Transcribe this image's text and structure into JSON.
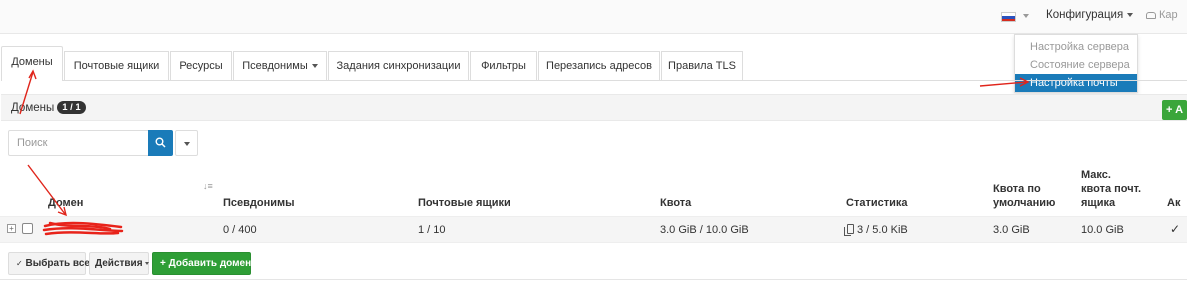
{
  "navbar": {
    "config_label": "Конфигурация",
    "account_label": "Кар"
  },
  "config_dropdown": [
    {
      "label": "Настройка сервера",
      "active": false
    },
    {
      "label": "Состояние сервера",
      "active": false
    },
    {
      "label": "Настройка почты",
      "active": true
    }
  ],
  "tabs": [
    {
      "label": "Домены",
      "active": true
    },
    {
      "label": "Почтовые ящики",
      "active": false
    },
    {
      "label": "Ресурсы",
      "active": false
    },
    {
      "label": "Псевдонимы",
      "active": false,
      "has_caret": true
    },
    {
      "label": "Задания синхронизации",
      "active": false
    },
    {
      "label": "Фильтры",
      "active": false
    },
    {
      "label": "Перезапись адресов",
      "active": false
    },
    {
      "label": "Правила TLS",
      "active": false
    }
  ],
  "panel": {
    "title": "Домены",
    "count_badge": "1 / 1",
    "add_button_partial": "+ A"
  },
  "search": {
    "placeholder": "Поиск",
    "value": ""
  },
  "table": {
    "headers": {
      "domain": "Домен",
      "aliases": "Псевдонимы",
      "mailboxes": "Почтовые ящики",
      "quota": "Квота",
      "stats": "Статистика",
      "default_quota_1": "Квота по",
      "default_quota_2": "умолчанию",
      "max_quota_1": "Макс.",
      "max_quota_2": "квота почт.",
      "max_quota_3": "ящика",
      "active_partial": "Ак"
    },
    "rows": [
      {
        "domain": "",
        "aliases": "0 / 400",
        "mailboxes": "1 / 10",
        "quota": "3.0 GiB / 10.0 GiB",
        "stats": "3 / 5.0 KiB",
        "default_quota": "3.0 GiB",
        "max_quota": "10.0 GiB",
        "active": "✓"
      }
    ]
  },
  "actions": {
    "select_all": "Выбрать все",
    "actions": "Действия",
    "add_domain": "Добавить домен"
  },
  "colors": {
    "primary": "#1a7bb9",
    "success": "#2e9e36",
    "annotation": "#e0251b"
  }
}
